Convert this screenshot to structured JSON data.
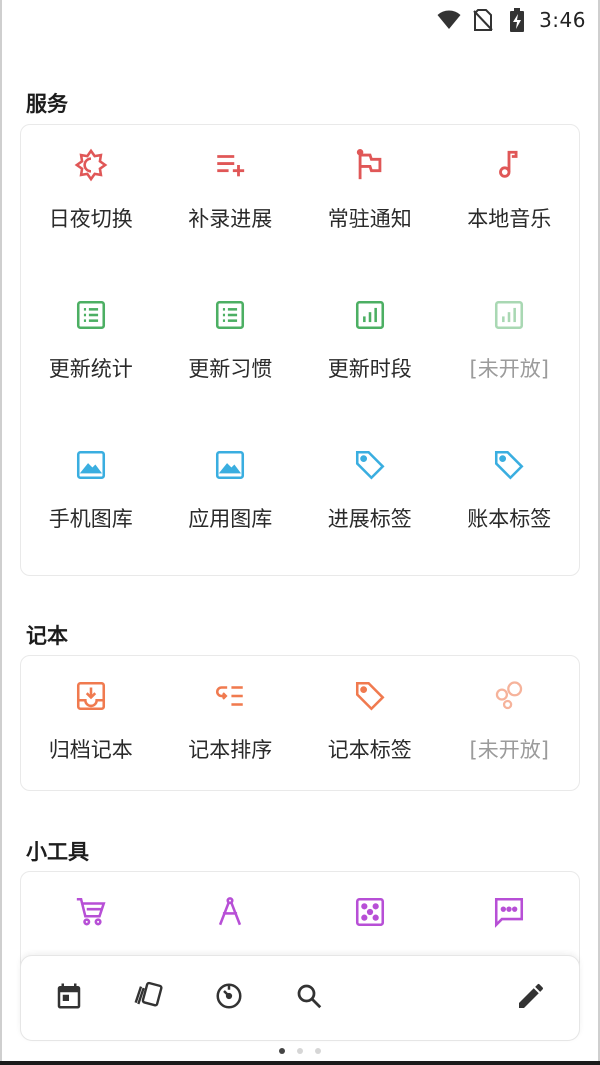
{
  "status_bar": {
    "time": "3:46",
    "icons": [
      "wifi-icon",
      "no-sim-icon",
      "battery-charging-icon"
    ]
  },
  "sections": [
    {
      "title": "服务",
      "items": [
        {
          "label": "日夜切换",
          "icon": "day-night-icon",
          "color": "#e05757",
          "enabled": true
        },
        {
          "label": "补录进展",
          "icon": "playlist-add-icon",
          "color": "#e05757",
          "enabled": true
        },
        {
          "label": "常驻通知",
          "icon": "flag-icon",
          "color": "#e05757",
          "enabled": true
        },
        {
          "label": "本地音乐",
          "icon": "music-note-icon",
          "color": "#e05757",
          "enabled": true
        },
        {
          "label": "更新统计",
          "icon": "list-doc-icon",
          "color": "#4caf63",
          "enabled": true
        },
        {
          "label": "更新习惯",
          "icon": "list-doc-icon",
          "color": "#4caf63",
          "enabled": true
        },
        {
          "label": "更新时段",
          "icon": "bar-chart-icon",
          "color": "#4caf63",
          "enabled": true
        },
        {
          "label": "[未开放]",
          "icon": "bar-chart-icon",
          "color": "#a9d8b3",
          "enabled": false
        },
        {
          "label": "手机图库",
          "icon": "image-icon",
          "color": "#3aaee0",
          "enabled": true
        },
        {
          "label": "应用图库",
          "icon": "image-icon",
          "color": "#3aaee0",
          "enabled": true
        },
        {
          "label": "进展标签",
          "icon": "tag-icon",
          "color": "#3aaee0",
          "enabled": true
        },
        {
          "label": "账本标签",
          "icon": "tag-icon",
          "color": "#3aaee0",
          "enabled": true
        }
      ]
    },
    {
      "title": "记本",
      "items": [
        {
          "label": "归档记本",
          "icon": "archive-icon",
          "color": "#f07a4f",
          "enabled": true
        },
        {
          "label": "记本排序",
          "icon": "sort-list-icon",
          "color": "#f07a4f",
          "enabled": true
        },
        {
          "label": "记本标签",
          "icon": "tag-icon",
          "color": "#f07a4f",
          "enabled": true
        },
        {
          "label": "[未开放]",
          "icon": "bubbles-icon",
          "color": "#f6b39b",
          "enabled": false
        }
      ]
    },
    {
      "title": "小工具",
      "items": [
        {
          "label": "",
          "icon": "cart-icon",
          "color": "#b74fd6",
          "enabled": true
        },
        {
          "label": "",
          "icon": "compass-icon",
          "color": "#b74fd6",
          "enabled": true
        },
        {
          "label": "",
          "icon": "dice-icon",
          "color": "#b74fd6",
          "enabled": true
        },
        {
          "label": "",
          "icon": "chat-icon",
          "color": "#b74fd6",
          "enabled": true
        }
      ]
    }
  ],
  "bottom_bar": {
    "left_icons": [
      "calendar-icon",
      "cards-icon",
      "timer-icon",
      "search-icon"
    ],
    "right_icon": "edit-icon"
  },
  "pager": {
    "count": 3,
    "active": 0
  }
}
